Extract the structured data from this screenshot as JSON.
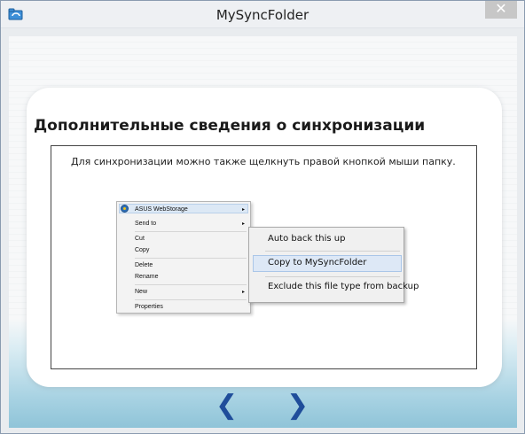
{
  "window": {
    "title": "MySyncFolder",
    "close_glyph": "✕"
  },
  "page": {
    "heading": "Дополнительные сведения о синхронизации",
    "instruction": "Для синхронизации можно также щелкнуть правой кнопкой мыши папку."
  },
  "context_menu": {
    "items": [
      {
        "label": "ASUS WebStorage",
        "icon": "asus-webstorage-icon",
        "has_submenu": true
      },
      {
        "label": "Send to",
        "has_submenu": true
      },
      {
        "label": "Cut"
      },
      {
        "label": "Copy"
      },
      {
        "label": "Delete"
      },
      {
        "label": "Rename"
      },
      {
        "label": "New",
        "has_submenu": true
      },
      {
        "label": "Properties"
      }
    ],
    "submenu_arrow": "▸"
  },
  "submenu": {
    "items": [
      {
        "label": "Auto back this up"
      },
      {
        "label": "Copy to MySyncFolder",
        "highlighted": true
      },
      {
        "label": "Exclude this file type from backup"
      }
    ]
  },
  "nav": {
    "prev_glyph": "❮",
    "next_glyph": "❯"
  },
  "colors": {
    "nav_arrows": "#1f4d9a",
    "bottom_gradient": "#8fc4d8"
  }
}
